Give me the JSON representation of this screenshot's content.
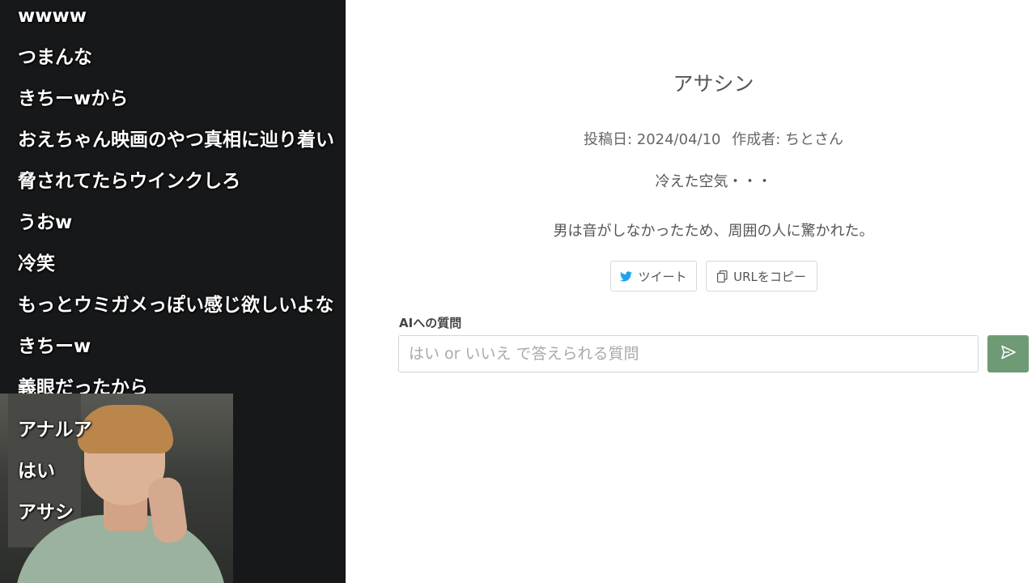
{
  "chat": {
    "messages": [
      "wwww",
      "つまんな",
      "きちーwから",
      "おえちゃん映画のやつ真相に辿り着い",
      "脅されてたらウインクしろ",
      "うおw",
      "冷笑",
      "もっとウミガメっぽい感じ欲しいよな",
      "きちーw",
      "義眼だったから",
      "アナルア",
      "はい",
      "アサシ"
    ]
  },
  "post": {
    "title": "アサシン",
    "date_label": "投稿日: 2024/04/10",
    "author_label": "作成者: ちとさん",
    "summary": "冷えた空気・・・",
    "answer": "男は音がしなかったため、周囲の人に驚かれた。"
  },
  "share": {
    "tweet_label": "ツイート",
    "copy_url_label": "URLをコピー",
    "twitter_color": "#1da1f2"
  },
  "ask": {
    "label": "AIへの質問",
    "placeholder": "はい or いいえ で答えられる質問",
    "value": "",
    "send_icon": "send-icon",
    "accent_color": "#6f9a76"
  }
}
